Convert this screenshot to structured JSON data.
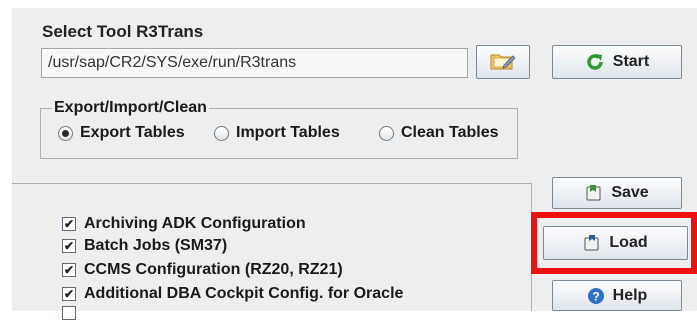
{
  "tool": {
    "section_label": "Select Tool R3Trans",
    "path_value": "/usr/sap/CR2/SYS/exe/run/R3trans",
    "start_label": "Start"
  },
  "mode": {
    "group_title": "Export/Import/Clean",
    "options": [
      {
        "label": "Export Tables",
        "selected": true
      },
      {
        "label": "Import Tables",
        "selected": false
      },
      {
        "label": "Clean Tables",
        "selected": false
      }
    ]
  },
  "actions": {
    "save_label": "Save",
    "load_label": "Load",
    "help_label": "Help"
  },
  "items": [
    {
      "label": "Archiving ADK Configuration",
      "checked": true
    },
    {
      "label": "Batch Jobs (SM37)",
      "checked": true
    },
    {
      "label": "CCMS Configuration (RZ20, RZ21)",
      "checked": true
    },
    {
      "label": "Additional DBA Cockpit Config. for Oracle",
      "checked": true
    }
  ],
  "colors": {
    "highlight": "#ee1111",
    "start_icon": "#2e9b2e",
    "help_icon": "#2f6fc8"
  }
}
